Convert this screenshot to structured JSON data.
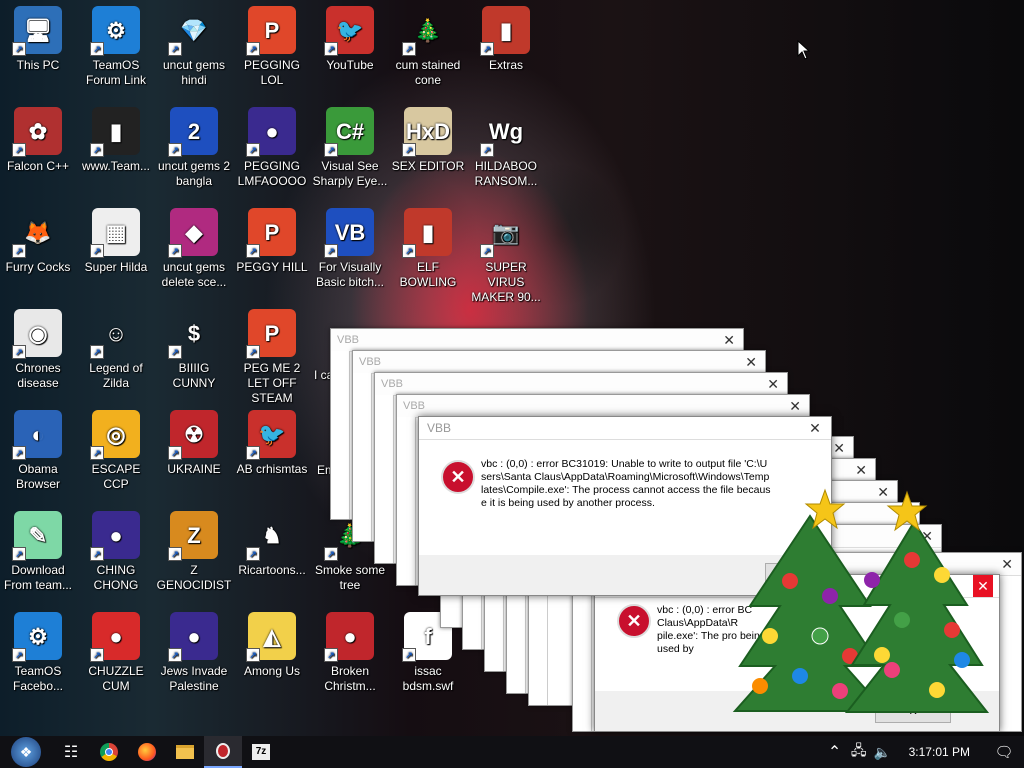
{
  "desktop": {
    "icons": [
      {
        "label": "This PC",
        "glyph": "🖥",
        "bg": "#2d6fb8"
      },
      {
        "label": "TeamOS Forum Link",
        "glyph": "⚙",
        "bg": "#1e7fd6"
      },
      {
        "label": "uncut gems hindi",
        "glyph": "💎",
        "bg": "transparent"
      },
      {
        "label": "PEGGING LOL",
        "glyph": "P",
        "bg": "#e0472a"
      },
      {
        "label": "YouTube",
        "glyph": "🐦",
        "bg": "#c9302c"
      },
      {
        "label": "cum stained cone",
        "glyph": "🎄",
        "bg": "transparent"
      },
      {
        "label": "Extras",
        "glyph": "▮",
        "bg": "#c0392b"
      },
      {
        "label": "Falcon C++",
        "glyph": "✿",
        "bg": "#b03030"
      },
      {
        "label": "www.Team...",
        "glyph": "▮",
        "bg": "#222"
      },
      {
        "label": "uncut gems 2 bangla",
        "glyph": "2",
        "bg": "#1e4fbf"
      },
      {
        "label": "PEGGING LMFAOOOO",
        "glyph": "●",
        "bg": "#3a2a8f"
      },
      {
        "label": "Visual See Sharply Eye...",
        "glyph": "C#",
        "bg": "#3a9a3a"
      },
      {
        "label": "SEX EDITOR",
        "glyph": "HxD",
        "bg": "#d8c8a0"
      },
      {
        "label": "HILDABOO RANSOM...",
        "glyph": "Wg",
        "bg": "transparent"
      },
      {
        "label": "Furry Cocks",
        "glyph": "🦊",
        "bg": "transparent"
      },
      {
        "label": "Super Hilda",
        "glyph": "▦",
        "bg": "#eee"
      },
      {
        "label": "uncut gems delete sce...",
        "glyph": "◆",
        "bg": "#b02a80"
      },
      {
        "label": "PEGGY HILL",
        "glyph": "P",
        "bg": "#e0472a"
      },
      {
        "label": "For Visually Basic bitch...",
        "glyph": "VB",
        "bg": "#1e4fbf"
      },
      {
        "label": "ELF BOWLING",
        "glyph": "▮",
        "bg": "#c0392b"
      },
      {
        "label": "SUPER VIRUS MAKER 90...",
        "glyph": "📷",
        "bg": "transparent"
      },
      {
        "label": "Chrones disease",
        "glyph": "◉",
        "bg": "#e8e8e8"
      },
      {
        "label": "Legend of Zilda",
        "glyph": "☺",
        "bg": "transparent"
      },
      {
        "label": "BIIIIG CUNNY",
        "glyph": "$",
        "bg": "transparent"
      },
      {
        "label": "PEG ME 2 LET OFF STEAM",
        "glyph": "P",
        "bg": "#e0472a"
      },
      {
        "label": "Obama Browser",
        "glyph": "◐",
        "bg": "#2a63b7"
      },
      {
        "label": "ESCAPE CCP",
        "glyph": "◎",
        "bg": "#f2b01e"
      },
      {
        "label": "UKRAINE",
        "glyph": "☢",
        "bg": "#c0262c"
      },
      {
        "label": "AB crhismtas",
        "glyph": "🐦",
        "bg": "#c9302c"
      },
      {
        "label": "Download From team...",
        "glyph": "✎",
        "bg": "#7ed8a6"
      },
      {
        "label": "CHING CHONG",
        "glyph": "●",
        "bg": "#3a2a8f"
      },
      {
        "label": "Z GENOCIDIST",
        "glyph": "Z",
        "bg": "#d88a1e"
      },
      {
        "label": "Ricartoons...",
        "glyph": "♞",
        "bg": "transparent"
      },
      {
        "label": "Smoke some tree",
        "glyph": "🎄",
        "bg": "transparent"
      },
      {
        "label": "TeamOS Facebo...",
        "glyph": "⚙",
        "bg": "#1e7fd6"
      },
      {
        "label": "CHUZZLE CUM",
        "glyph": "●",
        "bg": "#d82a2a"
      },
      {
        "label": "Jews Invade Palestine",
        "glyph": "●",
        "bg": "#3a2a8f"
      },
      {
        "label": "Among Us",
        "glyph": "◭",
        "bg": "#f2d04a"
      },
      {
        "label": "Broken Christm...",
        "glyph": "●",
        "bg": "#c0262c"
      },
      {
        "label": "issac bdsm.swf",
        "glyph": "f",
        "bg": "#fff"
      }
    ],
    "partial_labels": [
      "I ca ho",
      "Em D"
    ]
  },
  "dialogs": {
    "title": "VBB",
    "close_glyph": "✕",
    "message": "vbc : (0,0) : error BC31019: Unable to write to output file 'C:\\Users\\Santa Claus\\AppData\\Roaming\\Microsoft\\Windows\\Templates\\Compile.exe': The process cannot access the file because it is being used by another process.",
    "message_short": "vbc : (0,0) : error BC Claus\\AppData\\R pile.exe': The pro being used by",
    "ok_label": "OK",
    "ok_partial": "O",
    "ok_partial2": "K"
  },
  "taskbar": {
    "clock": "3:17:01 PM",
    "tray_icons": [
      "chevron-up-icon",
      "network-icon",
      "volume-icon"
    ],
    "apps": [
      "task-view-icon",
      "chrome-icon",
      "firefox-icon",
      "explorer-icon",
      "app-icon",
      "7zip-icon"
    ],
    "zip_label": "7z"
  }
}
